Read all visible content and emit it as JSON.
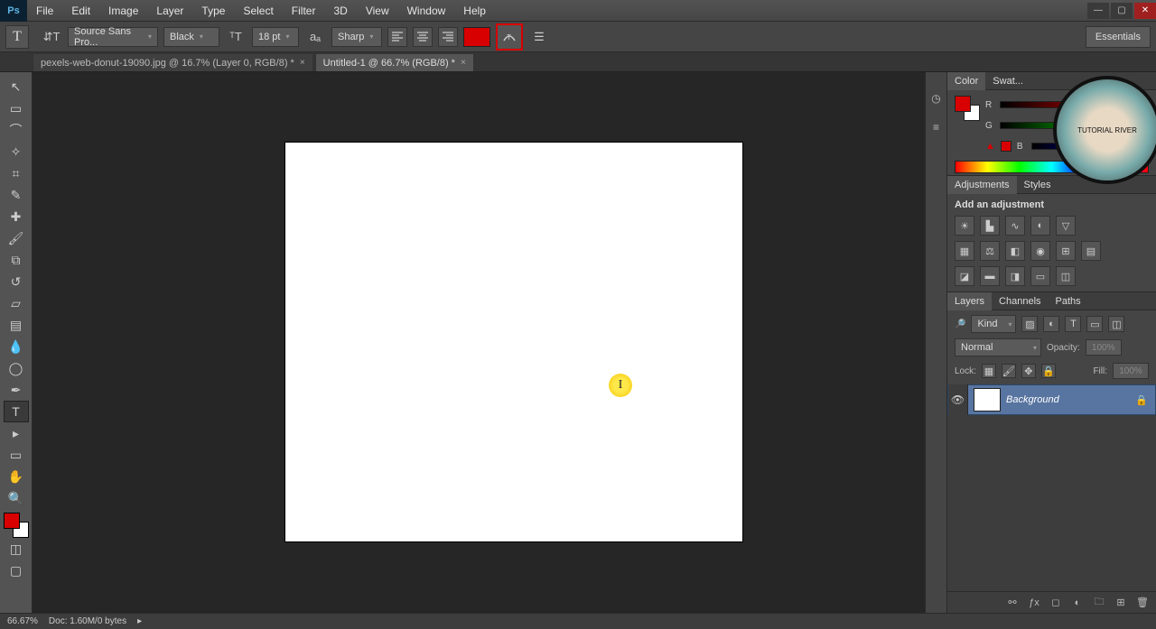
{
  "menu": {
    "items": [
      "File",
      "Edit",
      "Image",
      "Layer",
      "Type",
      "Select",
      "Filter",
      "3D",
      "View",
      "Window",
      "Help"
    ]
  },
  "options": {
    "font_family": "Source Sans Pro...",
    "font_style": "Black",
    "font_size": "18 pt",
    "anti_alias": "Sharp",
    "text_color": "#d80000"
  },
  "workspace": {
    "name": "Essentials"
  },
  "tabs": [
    {
      "title": "pexels-web-donut-19090.jpg @ 16.7% (Layer 0, RGB/8) *"
    },
    {
      "title": "Untitled-1 @ 66.7% (RGB/8) *"
    }
  ],
  "panels": {
    "color": {
      "tabs": [
        "Color",
        "Swat..."
      ],
      "channels": [
        "R",
        "G",
        "B"
      ],
      "fg": "#d80000",
      "bg": "#ffffff"
    },
    "adjustments": {
      "tabs": [
        "Adjustments",
        "Styles"
      ],
      "heading": "Add an adjustment"
    },
    "layers": {
      "tabs": [
        "Layers",
        "Channels",
        "Paths"
      ],
      "filter_kind": "Kind",
      "blend_mode": "Normal",
      "opacity_label": "Opacity:",
      "opacity_value": "100%",
      "lock_label": "Lock:",
      "fill_label": "Fill:",
      "fill_value": "100%",
      "items": [
        {
          "name": "Background",
          "locked": true
        }
      ]
    }
  },
  "status": {
    "zoom": "66.67%",
    "doc_info": "Doc: 1.60M/0 bytes"
  }
}
